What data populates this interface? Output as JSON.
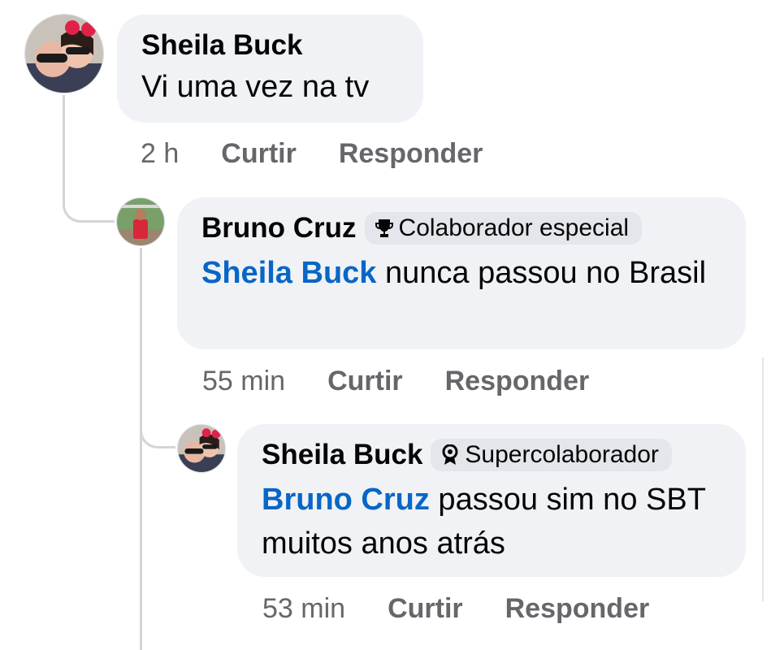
{
  "comments": [
    {
      "author": "Sheila Buck",
      "badge": "",
      "mention": "",
      "text": "Vi uma vez na tv",
      "time": "2 h",
      "like_label": "Curtir",
      "reply_label": "Responder",
      "avatar_icon": "profile-photo-couple"
    },
    {
      "author": "Bruno Cruz",
      "badge": "Colaborador especial",
      "badge_icon": "trophy-icon",
      "mention": "Sheila Buck",
      "text": " nunca passou no Brasil",
      "time": "55 min",
      "like_label": "Curtir",
      "reply_label": "Responder",
      "avatar_icon": "profile-photo-man-red-shirt"
    },
    {
      "author": "Sheila Buck",
      "badge": "Supercolaborador",
      "badge_icon": "medal-icon",
      "mention": "Bruno Cruz",
      "text": " passou sim no SBT muitos anos atrás",
      "time": "53 min",
      "like_label": "Curtir",
      "reply_label": "Responder",
      "avatar_icon": "profile-photo-couple"
    }
  ],
  "colors": {
    "bubble": "#f0f2f5",
    "mention": "#0866c6",
    "meta": "#65676b",
    "badge_bg": "#e4e6eb",
    "thread_line": "#d3d5d9"
  }
}
